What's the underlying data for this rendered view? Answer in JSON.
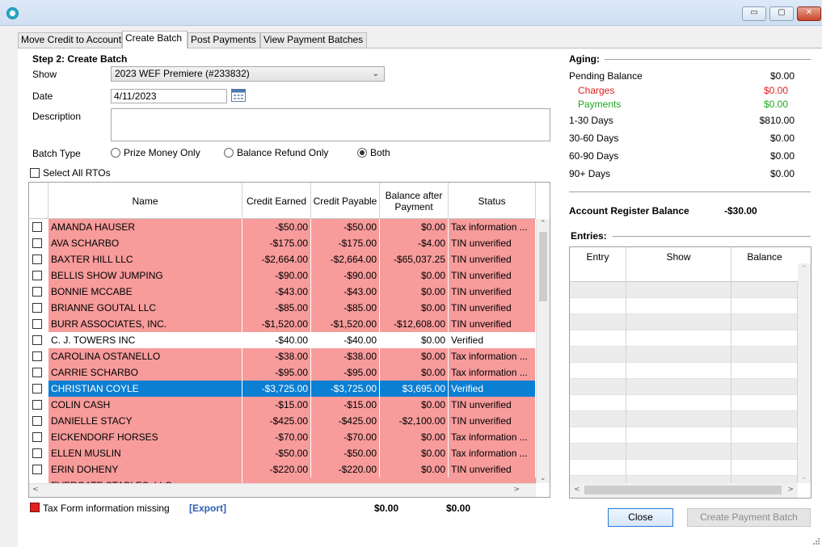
{
  "window": {
    "minimize_glyph": "▭",
    "maximize_glyph": "▢",
    "close_glyph": "✕"
  },
  "tabs": [
    {
      "label": "Move Credit to Account"
    },
    {
      "label": "Create Batch"
    },
    {
      "label": "Post Payments"
    },
    {
      "label": "View Payment Batches"
    }
  ],
  "step": {
    "title": "Step 2: Create Batch"
  },
  "form": {
    "show_label": "Show",
    "show_value": "2023 WEF Premiere (#233832)",
    "date_label": "Date",
    "date_value": "4/11/2023",
    "description_label": "Description",
    "description_value": "",
    "batch_type_label": "Batch Type",
    "batch_types": [
      "Prize Money Only",
      "Balance Refund Only",
      "Both"
    ],
    "batch_type_selected": "Both",
    "select_all_label": "Select All RTOs"
  },
  "grid": {
    "columns": [
      "Name",
      "Credit Earned",
      "Credit Payable",
      "Balance after Payment",
      "Status"
    ],
    "rows": [
      {
        "name": "AMANDA HAUSER",
        "earned": "-$50.00",
        "payable": "-$50.00",
        "balance": "$0.00",
        "status": "Tax information ...",
        "state": "err"
      },
      {
        "name": "AVA SCHARBO",
        "earned": "-$175.00",
        "payable": "-$175.00",
        "balance": "-$4.00",
        "status": "TIN unverified",
        "state": "err"
      },
      {
        "name": "BAXTER HILL LLC",
        "earned": "-$2,664.00",
        "payable": "-$2,664.00",
        "balance": "-$65,037.25",
        "status": "TIN unverified",
        "state": "err"
      },
      {
        "name": "BELLIS SHOW JUMPING",
        "earned": "-$90.00",
        "payable": "-$90.00",
        "balance": "$0.00",
        "status": "TIN unverified",
        "state": "err"
      },
      {
        "name": "BONNIE MCCABE",
        "earned": "-$43.00",
        "payable": "-$43.00",
        "balance": "$0.00",
        "status": "TIN unverified",
        "state": "err"
      },
      {
        "name": "BRIANNE GOUTAL LLC",
        "earned": "-$85.00",
        "payable": "-$85.00",
        "balance": "$0.00",
        "status": "TIN unverified",
        "state": "err"
      },
      {
        "name": "BURR ASSOCIATES, INC.",
        "earned": "-$1,520.00",
        "payable": "-$1,520.00",
        "balance": "-$12,608.00",
        "status": "TIN unverified",
        "state": "err"
      },
      {
        "name": "C. J. TOWERS INC",
        "earned": "-$40.00",
        "payable": "-$40.00",
        "balance": "$0.00",
        "status": "Verified",
        "state": "ok"
      },
      {
        "name": "CAROLINA OSTANELLO",
        "earned": "-$38.00",
        "payable": "-$38.00",
        "balance": "$0.00",
        "status": "Tax information ...",
        "state": "err"
      },
      {
        "name": "CARRIE SCHARBO",
        "earned": "-$95.00",
        "payable": "-$95.00",
        "balance": "$0.00",
        "status": "Tax information ...",
        "state": "err"
      },
      {
        "name": "CHRISTIAN COYLE",
        "earned": "-$3,725.00",
        "payable": "-$3,725.00",
        "balance": "$3,695.00",
        "status": "Verified",
        "state": "sel"
      },
      {
        "name": "COLIN CASH",
        "earned": "-$15.00",
        "payable": "-$15.00",
        "balance": "$0.00",
        "status": "TIN unverified",
        "state": "err"
      },
      {
        "name": "DANIELLE STACY",
        "earned": "-$425.00",
        "payable": "-$425.00",
        "balance": "-$2,100.00",
        "status": "TIN unverified",
        "state": "err"
      },
      {
        "name": "EICKENDORF HORSES",
        "earned": "-$70.00",
        "payable": "-$70.00",
        "balance": "$0.00",
        "status": "Tax information ...",
        "state": "err"
      },
      {
        "name": "ELLEN MUSLIN",
        "earned": "-$50.00",
        "payable": "-$50.00",
        "balance": "$0.00",
        "status": "Tax information ...",
        "state": "err"
      },
      {
        "name": "ERIN DOHENY",
        "earned": "-$220.00",
        "payable": "-$220.00",
        "balance": "$0.00",
        "status": "TIN unverified",
        "state": "err"
      }
    ],
    "partial_row_name": "EVERGATE STABLES, LLC"
  },
  "footer": {
    "legend_label": "Tax Form information missing",
    "export_label": "[Export]",
    "total_payable": "$0.00",
    "total_balance": "$0.00"
  },
  "aging": {
    "title": "Aging:",
    "rows": [
      {
        "label": "Pending Balance",
        "value": "$0.00"
      },
      {
        "label": "Charges",
        "value": "$0.00",
        "color": "#e02020"
      },
      {
        "label": "Payments",
        "value": "$0.00",
        "color": "#1ea81e"
      },
      {
        "label": "1-30 Days",
        "value": "$810.00"
      },
      {
        "label": "30-60 Days",
        "value": "$0.00"
      },
      {
        "label": "60-90 Days",
        "value": "$0.00"
      },
      {
        "label": "90+ Days",
        "value": "$0.00"
      }
    ],
    "register_label": "Account Register Balance",
    "register_value": "-$30.00"
  },
  "entries": {
    "title": "Entries:",
    "columns": [
      "Entry",
      "Show",
      "Balance"
    ]
  },
  "buttons": {
    "close": "Close",
    "create": "Create Payment Batch"
  },
  "icons": {
    "app": "app-logo-icon",
    "calendar": "calendar-icon",
    "dropdown": "chevron-down-icon"
  }
}
